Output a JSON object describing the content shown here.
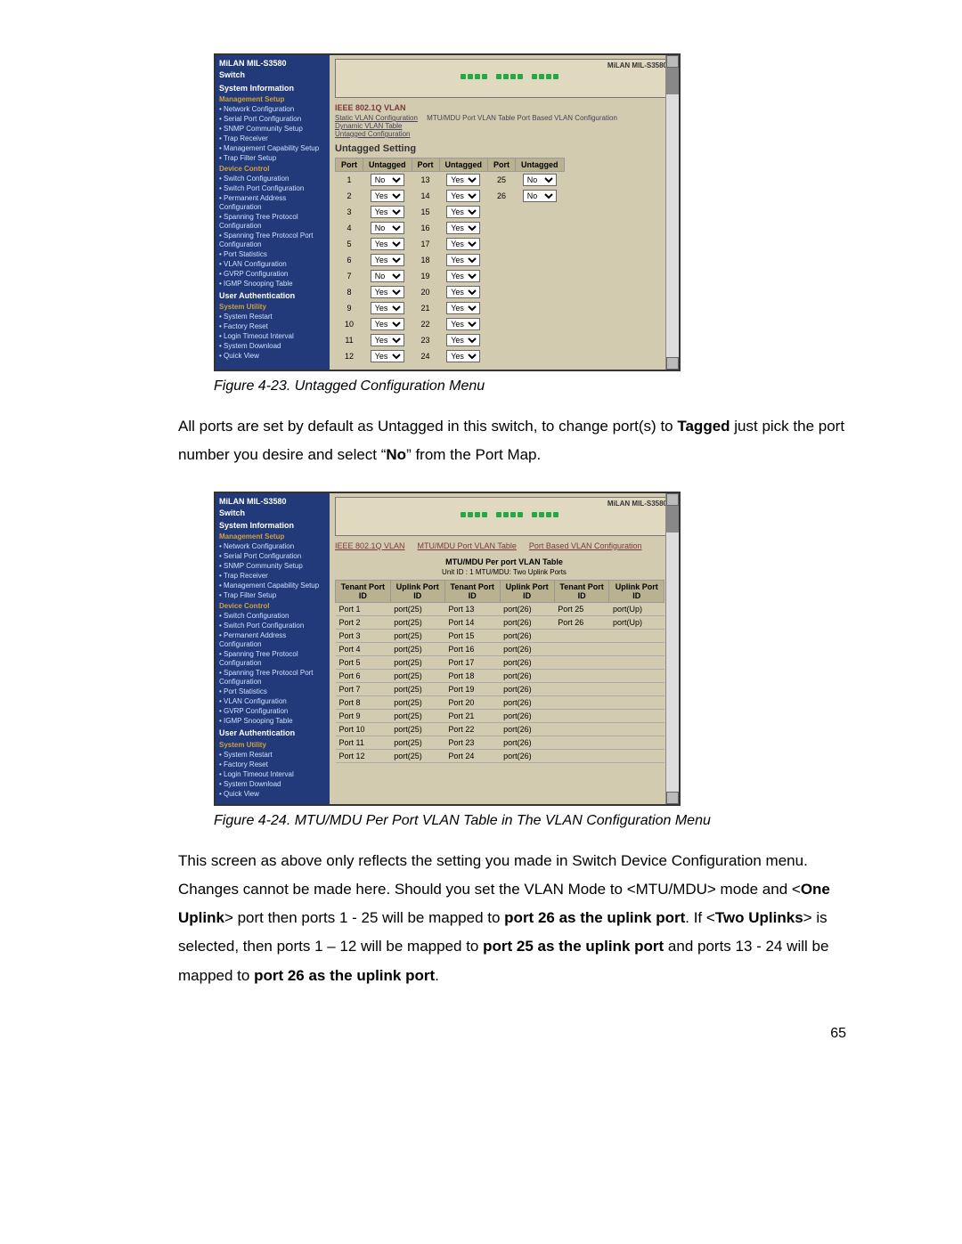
{
  "page_number": "65",
  "figure1": {
    "caption": "Figure 4-23. Untagged Configuration Menu",
    "device_brand": "MiLAN MIL-S3580",
    "device_sub": "Switch",
    "sidebar_sections": {
      "sysinfo": "System Information",
      "mgmt": "Management Setup",
      "mgmt_items": [
        "Network Configuration",
        "Serial Port Configuration",
        "SNMP Community Setup",
        "Trap Receiver",
        "Management Capability Setup",
        "Trap Filter Setup"
      ],
      "devctrl": "Device Control",
      "dev_items": [
        "Switch Configuration",
        "Switch Port Configuration",
        "Permanent Address Configuration",
        "Spanning Tree Protocol Configuration",
        "Spanning Tree Protocol Port Configuration",
        "Port Statistics",
        "VLAN Configuration",
        "GVRP Configuration",
        "IGMP Snooping Table"
      ],
      "userauth": "User Authentication",
      "sysutil": "System Utility",
      "util_items": [
        "System Restart",
        "Factory Reset",
        "Login Timeout Interval",
        "System Download",
        "Quick View"
      ]
    },
    "top_tab": "IEEE 802.1Q VLAN",
    "top_links": [
      "Static VLAN Configuration",
      "Dynamic VLAN Table",
      "Untagged Configuration"
    ],
    "top_right": "MTU/MDU Port VLAN Table   Port Based VLAN Configuration",
    "panel_title": "Untagged Setting",
    "col_headers": [
      "Port",
      "Untagged",
      "Port",
      "Untagged",
      "Port",
      "Untagged"
    ],
    "rows": [
      {
        "p1": "1",
        "v1": "No",
        "p2": "13",
        "v2": "Yes",
        "p3": "25",
        "v3": "No"
      },
      {
        "p1": "2",
        "v1": "Yes",
        "p2": "14",
        "v2": "Yes",
        "p3": "26",
        "v3": "No"
      },
      {
        "p1": "3",
        "v1": "Yes",
        "p2": "15",
        "v2": "Yes"
      },
      {
        "p1": "4",
        "v1": "No",
        "p2": "16",
        "v2": "Yes"
      },
      {
        "p1": "5",
        "v1": "Yes",
        "p2": "17",
        "v2": "Yes"
      },
      {
        "p1": "6",
        "v1": "Yes",
        "p2": "18",
        "v2": "Yes"
      },
      {
        "p1": "7",
        "v1": "No",
        "p2": "19",
        "v2": "Yes"
      },
      {
        "p1": "8",
        "v1": "Yes",
        "p2": "20",
        "v2": "Yes"
      },
      {
        "p1": "9",
        "v1": "Yes",
        "p2": "21",
        "v2": "Yes"
      },
      {
        "p1": "10",
        "v1": "Yes",
        "p2": "22",
        "v2": "Yes"
      },
      {
        "p1": "11",
        "v1": "Yes",
        "p2": "23",
        "v2": "Yes"
      },
      {
        "p1": "12",
        "v1": "Yes",
        "p2": "24",
        "v2": "Yes"
      }
    ]
  },
  "para1_parts": {
    "a": "All ports are set by default as Untagged in this switch, to change port(s) to ",
    "b": "Tagged",
    "c": " just pick the port number you desire and select “",
    "d": "No",
    "e": "” from the Port Map."
  },
  "figure2": {
    "caption": "Figure 4-24. MTU/MDU Per Port VLAN Table in The VLAN Configuration Menu",
    "device_brand": "MiLAN MIL-S3580",
    "device_sub": "Switch",
    "top_tabs": [
      "IEEE 802.1Q VLAN",
      "MTU/MDU Port VLAN Table",
      "Port Based VLAN Configuration"
    ],
    "panel_title": "MTU/MDU Per port VLAN Table",
    "panel_note": "Unit ID : 1 MTU/MDU: Two Uplink Ports",
    "col_headers": [
      "Tenant Port ID",
      "Uplink Port ID",
      "Tenant Port ID",
      "Uplink Port ID",
      "Tenant Port ID",
      "Uplink Port ID"
    ],
    "rows": [
      {
        "p1": "Port 1",
        "u1": "port(25)",
        "p2": "Port 13",
        "u2": "port(26)",
        "p3": "Port 25",
        "u3": "port(Up)"
      },
      {
        "p1": "Port 2",
        "u1": "port(25)",
        "p2": "Port 14",
        "u2": "port(26)",
        "p3": "Port 26",
        "u3": "port(Up)"
      },
      {
        "p1": "Port 3",
        "u1": "port(25)",
        "p2": "Port 15",
        "u2": "port(26)"
      },
      {
        "p1": "Port 4",
        "u1": "port(25)",
        "p2": "Port 16",
        "u2": "port(26)"
      },
      {
        "p1": "Port 5",
        "u1": "port(25)",
        "p2": "Port 17",
        "u2": "port(26)"
      },
      {
        "p1": "Port 6",
        "u1": "port(25)",
        "p2": "Port 18",
        "u2": "port(26)"
      },
      {
        "p1": "Port 7",
        "u1": "port(25)",
        "p2": "Port 19",
        "u2": "port(26)"
      },
      {
        "p1": "Port 8",
        "u1": "port(25)",
        "p2": "Port 20",
        "u2": "port(26)"
      },
      {
        "p1": "Port 9",
        "u1": "port(25)",
        "p2": "Port 21",
        "u2": "port(26)"
      },
      {
        "p1": "Port 10",
        "u1": "port(25)",
        "p2": "Port 22",
        "u2": "port(26)"
      },
      {
        "p1": "Port 11",
        "u1": "port(25)",
        "p2": "Port 23",
        "u2": "port(26)"
      },
      {
        "p1": "Port 12",
        "u1": "port(25)",
        "p2": "Port 24",
        "u2": "port(26)"
      }
    ]
  },
  "para2_parts": {
    "a": "This screen as above only reflects the setting you made in Switch Device Configuration menu.  Changes cannot be made here.  Should you set the VLAN Mode to <MTU/MDU> mode and <",
    "b": "One Uplink",
    "c": "> port then ports 1 - 25 will be mapped to ",
    "d": "port 26 as the uplink port",
    "e": ".  If <",
    "f": "Two Uplinks",
    "g": "> is selected, then ports 1 – 12 will be mapped to ",
    "h": "port 25 as the uplink port",
    "i": " and ports 13 - 24 will be mapped to ",
    "j": "port 26 as the uplink port",
    "k": "."
  }
}
